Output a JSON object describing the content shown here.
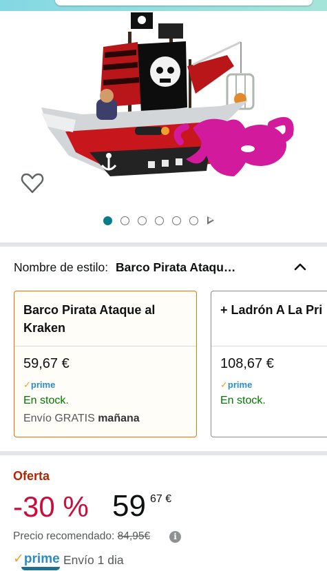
{
  "product_image": {
    "alt": "Barco Pirata Ataque al Kraken"
  },
  "carousel": {
    "count": 6,
    "active_index": 0
  },
  "style": {
    "label": "Nombre de estilo:",
    "selected_value": "Barco Pirata Ataqu…"
  },
  "variants": [
    {
      "title": "Barco Pirata Ataque al Kraken",
      "price": "59,67 €",
      "prime": "prime",
      "stock": "En stock.",
      "shipping_prefix": "Envío GRATIS",
      "shipping_day": "mañana",
      "selected": true
    },
    {
      "title": "+ Ladrón A La Pri",
      "price": "108,67 €",
      "prime": "prime",
      "stock": "En stock.",
      "selected": false
    }
  ],
  "offer": {
    "label": "Oferta",
    "discount": "-30 %",
    "price_whole": "59",
    "price_fraction": "67 €",
    "recommended_label": "Precio recomendado:",
    "recommended_price": "84,95€",
    "prime_label": "prime",
    "delivery": "Envío 1 dia"
  },
  "colors": {
    "accent_teal": "#087c8a",
    "offer_red": "#cc0c39",
    "stock_green": "#007600",
    "prime_blue": "#2e8bc0",
    "selected_border": "#e77600"
  },
  "icons": [
    "heart-icon",
    "chevron-up-icon",
    "info-icon",
    "next-arrow-icon",
    "checkmark-icon"
  ]
}
